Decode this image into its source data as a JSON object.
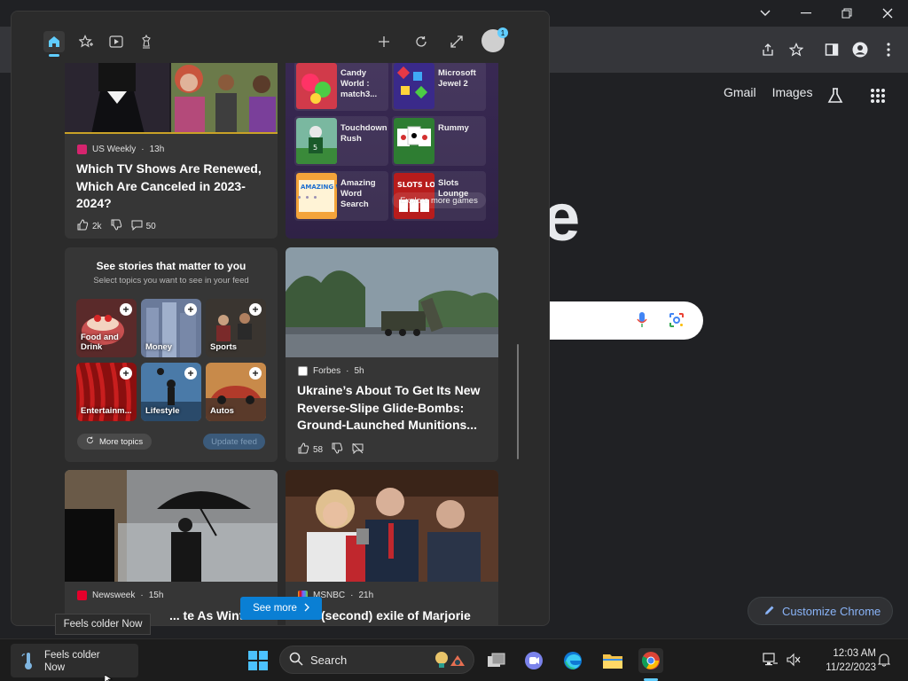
{
  "chrome": {
    "google_links": [
      "Gmail",
      "Images"
    ],
    "google_logo_fragment": "e",
    "customize_label": "Customize Chrome"
  },
  "widgets": {
    "header_icons": [
      "home-icon",
      "star-plus-icon",
      "video-icon",
      "chess-icon",
      "add-icon",
      "refresh-icon",
      "expand-icon",
      "avatar"
    ],
    "avatar_badge": "1",
    "articles": [
      {
        "source": "US Weekly",
        "age": "13h",
        "title": "Which TV Shows Are Renewed, Which Are Canceled in 2023-2024?",
        "likes": "2k",
        "comments": "50"
      },
      {
        "source": "Forbes",
        "age": "5h",
        "title": "Ukraine’s About To Get Its New Reverse-Slipe Glide-Bombs: Ground-Launched Munitions...",
        "likes": "58"
      },
      {
        "source": "Newsweek",
        "age": "15h",
        "title": "... te As Winter"
      },
      {
        "source": "MSNBC",
        "age": "21h",
        "title": "(second) exile of Marjorie"
      }
    ],
    "games": {
      "items": [
        {
          "name": "Candy World : match3..."
        },
        {
          "name": "Microsoft Jewel 2"
        },
        {
          "name": "Touchdown Rush"
        },
        {
          "name": "Rummy"
        },
        {
          "name": "Amazing Word Search"
        },
        {
          "name": "Slots Lounge"
        }
      ],
      "thumb_text": [
        "AMAZING WORD SEARCH",
        "SLOTS LOUNGE"
      ],
      "explore_label": "Explore more games"
    },
    "topics": {
      "title": "See stories that matter to you",
      "subtitle": "Select topics you want to see in your feed",
      "items": [
        {
          "label": "Food and Drink"
        },
        {
          "label": "Money"
        },
        {
          "label": "Sports"
        },
        {
          "label": "Entertainm..."
        },
        {
          "label": "Lifestyle"
        },
        {
          "label": "Autos"
        }
      ],
      "more_label": "More topics",
      "update_label": "Update feed"
    },
    "see_more_label": "See more"
  },
  "tooltip": "Feels colder Now",
  "taskbar": {
    "weather_line1": "Feels colder",
    "weather_line2": "Now",
    "search_label": "Search",
    "time": "12:03 AM",
    "date": "11/22/2023"
  }
}
